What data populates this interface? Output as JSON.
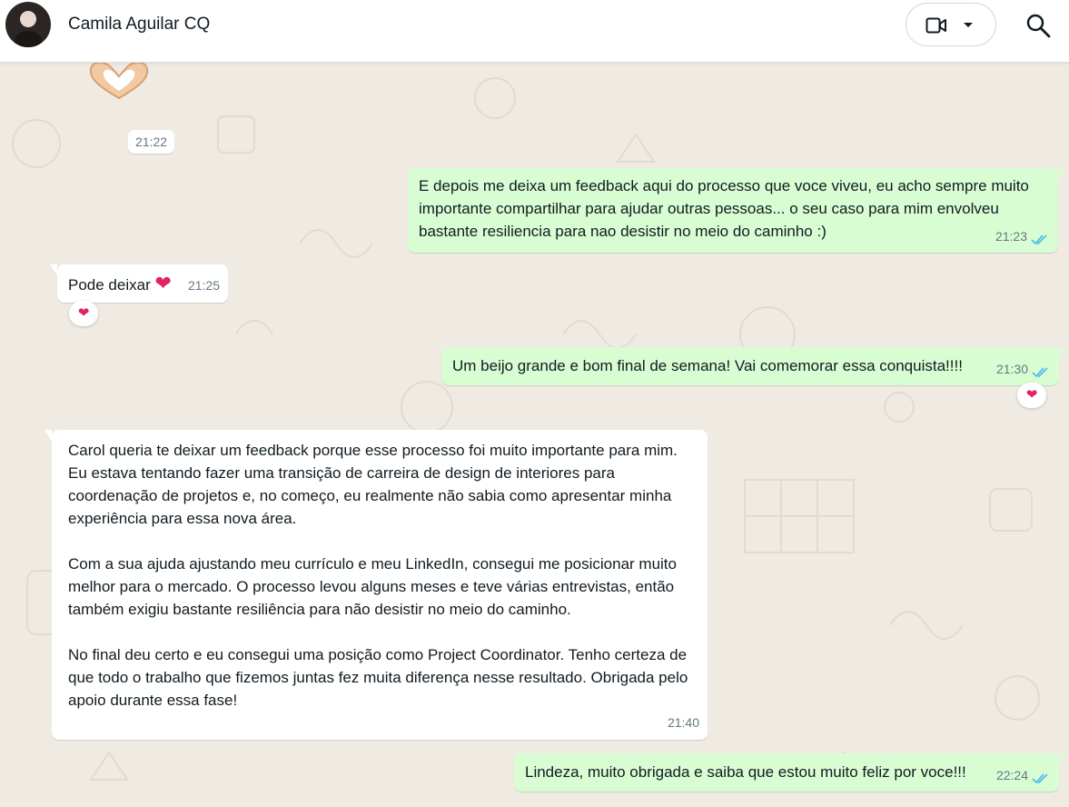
{
  "header": {
    "contact_name": "Camila Aguilar CQ",
    "video_icon": "video-camera-icon",
    "dropdown_icon": "chevron-down-icon",
    "search_icon": "search-icon"
  },
  "chat": {
    "sticker": {
      "icon": "heart-hands-icon",
      "time": "21:22"
    },
    "messages": [
      {
        "direction": "out",
        "text": "E depois me deixa um feedback aqui do processo que voce viveu, eu acho sempre muito importante compartilhar para ajudar outras pessoas... o seu caso para mim envolveu bastante resiliencia para nao desistir no meio do caminho :)",
        "time": "21:23",
        "status": "read"
      },
      {
        "direction": "in",
        "text": "Pode deixar ❤",
        "time": "21:25",
        "reaction": "❤"
      },
      {
        "direction": "out",
        "text": "Um beijo grande e bom final de semana! Vai comemorar essa conquista!!!!",
        "time": "21:30",
        "status": "read",
        "reaction": "❤"
      },
      {
        "direction": "in",
        "paragraphs": [
          "Carol queria te deixar um feedback porque esse processo foi muito importante para mim. Eu estava tentando fazer uma transição de carreira de design de interiores para coordenação de projetos e, no começo, eu realmente não sabia como apresentar minha experiência para essa nova área.",
          "Com a sua ajuda ajustando meu currículo e meu LinkedIn, consegui me posicionar muito melhor para o mercado. O processo levou alguns meses e teve várias entrevistas, então também exigiu bastante resiliência para não desistir no meio do caminho.",
          "No final deu certo e eu consegui uma posição como Project Coordinator. Tenho certeza de que todo o trabalho que fizemos juntas fez muita diferença nesse resultado. Obrigada pelo apoio durante essa fase!"
        ],
        "time": "21:40"
      },
      {
        "direction": "out",
        "text": "Lindeza, muito obrigada e saiba que estou muito feliz por voce!!!",
        "time": "22:24",
        "status": "read"
      }
    ]
  },
  "colors": {
    "incoming_bubble": "#ffffff",
    "outgoing_bubble": "#d9fdd3",
    "chat_background": "#efeae2",
    "read_ticks": "#53bdeb",
    "heart": "#e0245e"
  }
}
